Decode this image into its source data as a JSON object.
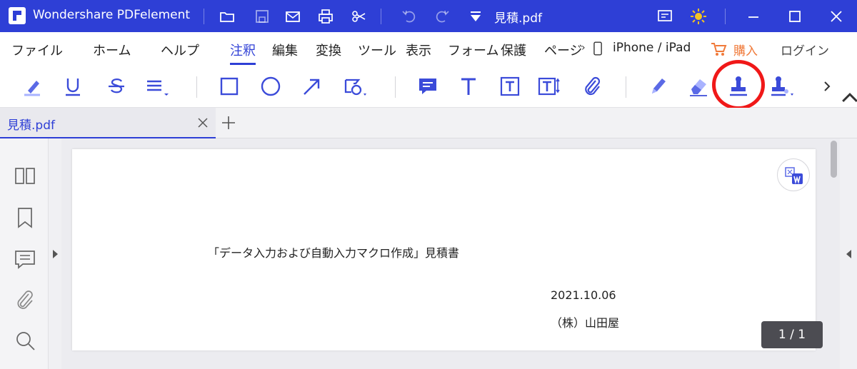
{
  "app": {
    "name": "Wondershare PDFelement",
    "filename": "見積.pdf"
  },
  "menu": {
    "items": [
      "ファイル",
      "ホーム",
      "ヘルプ",
      "注釈",
      "編集",
      "変換",
      "ツール",
      "表示",
      "フォーム",
      "保護",
      "ページ"
    ],
    "active": "注釈",
    "device": "iPhone / iPad",
    "buy": "購入",
    "login": "ログイン"
  },
  "toolbar": {
    "icons": [
      "highlight-icon",
      "underline-icon",
      "strikethrough-icon",
      "text-align-icon",
      "rectangle-icon",
      "ellipse-icon",
      "arrow-icon",
      "shape-icon",
      "note-icon",
      "text-icon",
      "textbox-icon",
      "callout-icon",
      "attachment-icon",
      "pencil-icon",
      "eraser-icon",
      "stamp-icon",
      "signature-icon"
    ],
    "accent_color": "#2e3fd6",
    "highlight_ring_color": "#f01818"
  },
  "tabs": {
    "active_tab": "見積.pdf"
  },
  "document": {
    "title": "「データ入力および自動入力マクロ作成」見積書",
    "date": "2021.10.06",
    "company": "（株）山田屋"
  },
  "pager": {
    "current": "1 / 1"
  }
}
